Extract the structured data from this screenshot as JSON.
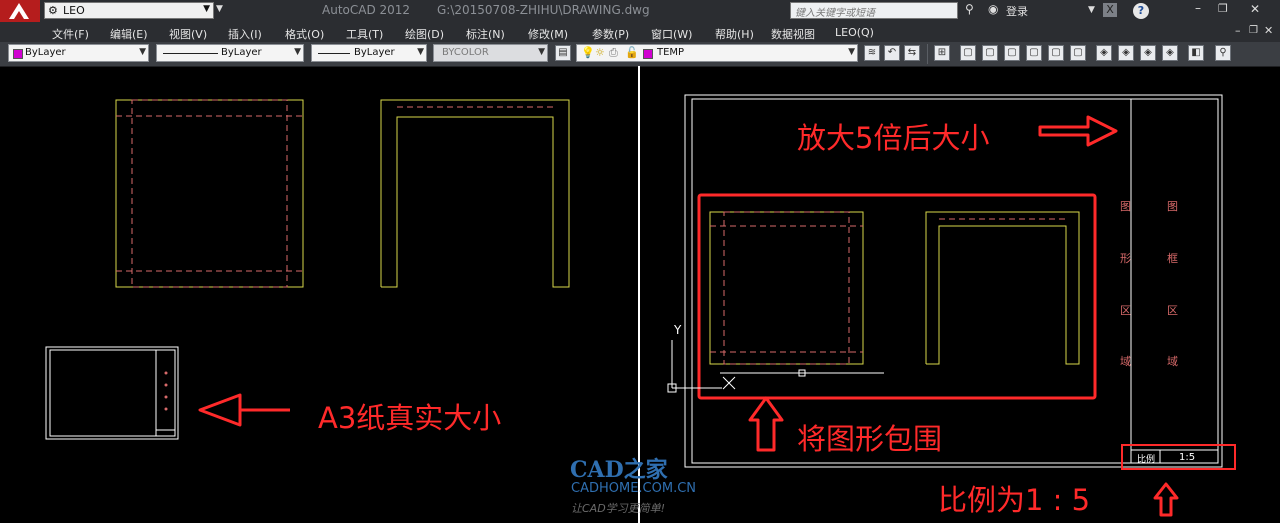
{
  "titlebar": {
    "workspace": "LEO",
    "app_title": "AutoCAD 2012",
    "file_path": "G:\\20150708-ZHIHU\\DRAWING.dwg",
    "search_placeholder": "键入关键字或短语",
    "login": "登录",
    "help": "?"
  },
  "menubar": {
    "items": [
      "文件(F)",
      "编辑(E)",
      "视图(V)",
      "插入(I)",
      "格式(O)",
      "工具(T)",
      "绘图(D)",
      "标注(N)",
      "修改(M)",
      "参数(P)",
      "窗口(W)",
      "帮助(H)",
      "数据视图",
      "LEO(Q)"
    ]
  },
  "toolbar": {
    "color": "ByLayer",
    "linetype": "ByLayer",
    "lineweight": "ByLayer",
    "plotstyle": "BYCOLOR",
    "layer": "TEMP"
  },
  "annotations": {
    "a3": "A3纸真实大小",
    "enlarge": "放大5倍后大小",
    "enclose": "将图形包围",
    "ratio": "比例为1 : 5"
  },
  "titleblock": {
    "col1": [
      "图",
      "形",
      "区",
      "域"
    ],
    "col2": [
      "图",
      "框",
      "区",
      "域"
    ],
    "scale_label": "比例",
    "scale_value": "1:5"
  },
  "ucs": {
    "x": "X",
    "y": "Y"
  },
  "watermark": {
    "logo": "CAD之家",
    "url": "CADHOME.COM.CN",
    "slogan": "让CAD学习更简单!"
  },
  "colors": {
    "shape": "#d8d84a",
    "dashed": "#d86a6a",
    "frame": "#ffffff",
    "annotation": "#ff2a2a",
    "watermark_blue": "#2f6fb0"
  }
}
